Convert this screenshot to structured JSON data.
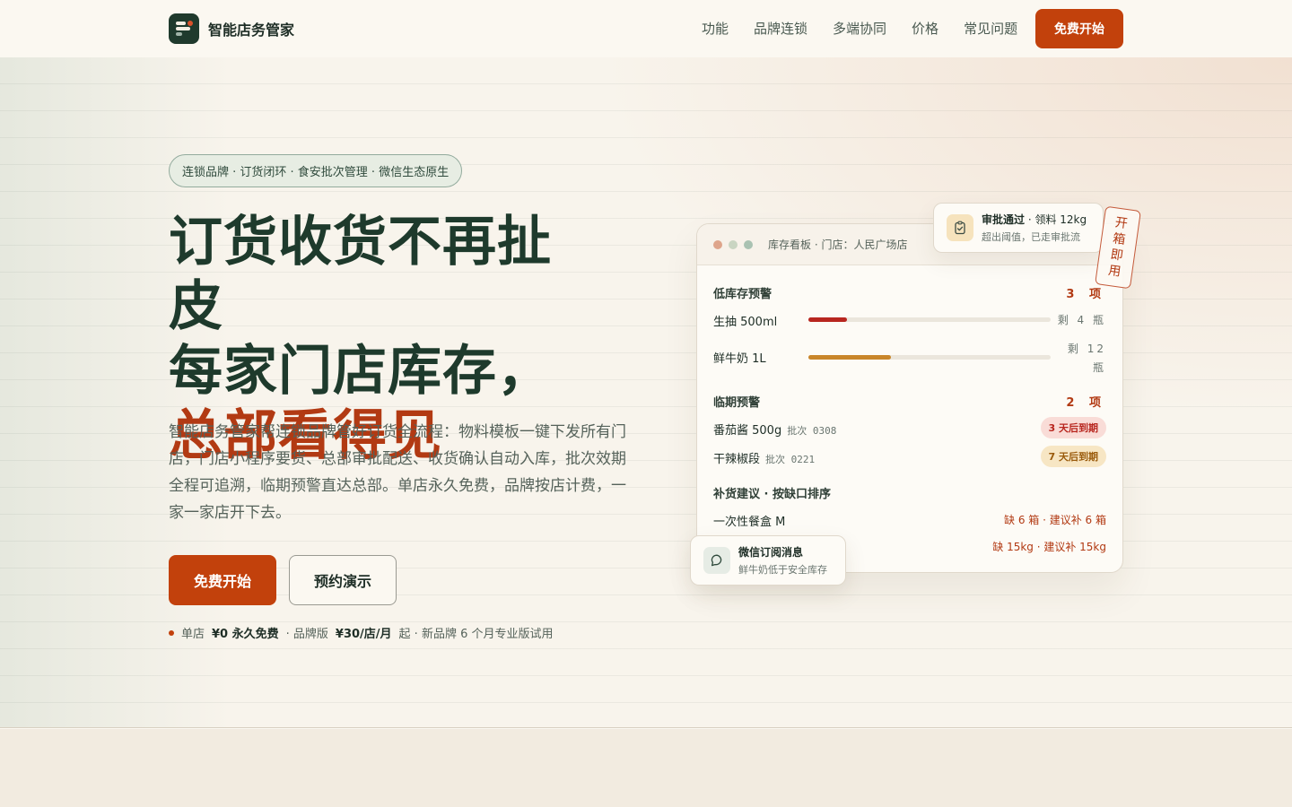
{
  "nav": {
    "brand": "智能店务管家",
    "links": [
      "功能",
      "品牌连锁",
      "多端协同",
      "价格",
      "常见问题"
    ],
    "cta": "免费开始"
  },
  "hero": {
    "pill": "连锁品牌 · 订货闭环 · 食安批次管理 · 微信生态原生",
    "headline_line1": "订货收货不再扯皮",
    "headline_line2": "每家门店库存，",
    "headline_accent": "总部看得见",
    "description": "智能店务管家帮连锁品牌管好订货全流程：物料模板一键下发所有门店，门店小程序要货、总部审批配送、收货确认自动入库，批次效期全程可追溯，临期预警直达总部。单店永久免费，品牌按店计费，一家一家店开下去。",
    "primary_button": "免费开始",
    "secondary_button": "预约演示",
    "pricing": {
      "p1": "单店",
      "p2": "¥0 永久免费",
      "p3": "· 品牌版",
      "p4": "¥30/店/月",
      "p5": "起 · 新品牌 6 个月专业版试用"
    }
  },
  "dashboard": {
    "title": "库存看板 · 门店：人民广场店",
    "low_stock": {
      "title": "低库存预警",
      "count": "3 项",
      "items": [
        {
          "name": "生抽 500ml",
          "remain": "剩 4 瓶",
          "fill": 0.16,
          "color": "#b8261f"
        },
        {
          "name": "鲜牛奶 1L",
          "remain_line1": "剩 12",
          "remain_line2": "瓶",
          "fill": 0.34,
          "color": "#c9862a"
        }
      ]
    },
    "expiry": {
      "title": "临期预警",
      "count": "2 项",
      "items": [
        {
          "name": "番茄酱 500g",
          "batch_label": "批次",
          "batch": "0308",
          "badge": "3 天后到期",
          "badge_bg": "#f9dcd7",
          "badge_fg": "#b8261f"
        },
        {
          "name": "干辣椒段",
          "batch_label": "批次",
          "batch": "0221",
          "badge": "7 天后到期",
          "badge_bg": "#f7e6c4",
          "badge_fg": "#9a5b0c"
        }
      ]
    },
    "restock": {
      "title": "补货建议 · 按缺口排序",
      "items": [
        {
          "name": "一次性餐盒 M",
          "suggestion": "缺 6 箱 · 建议补 6 箱"
        },
        {
          "name": "",
          "suggestion": "缺 15kg · 建议补 15kg"
        }
      ]
    }
  },
  "approval_toast": {
    "bold": "审批通过",
    "rest": " · 领料 12kg",
    "sub": "超出阈值，已走审批流"
  },
  "stamp": [
    "开",
    "箱",
    "即",
    "用"
  ],
  "wechat_toast": {
    "title": "微信订阅消息",
    "sub": "鲜牛奶低于安全库存"
  },
  "colors": {
    "accent": "#c2410c",
    "brand_green": "#1f3a2d"
  }
}
